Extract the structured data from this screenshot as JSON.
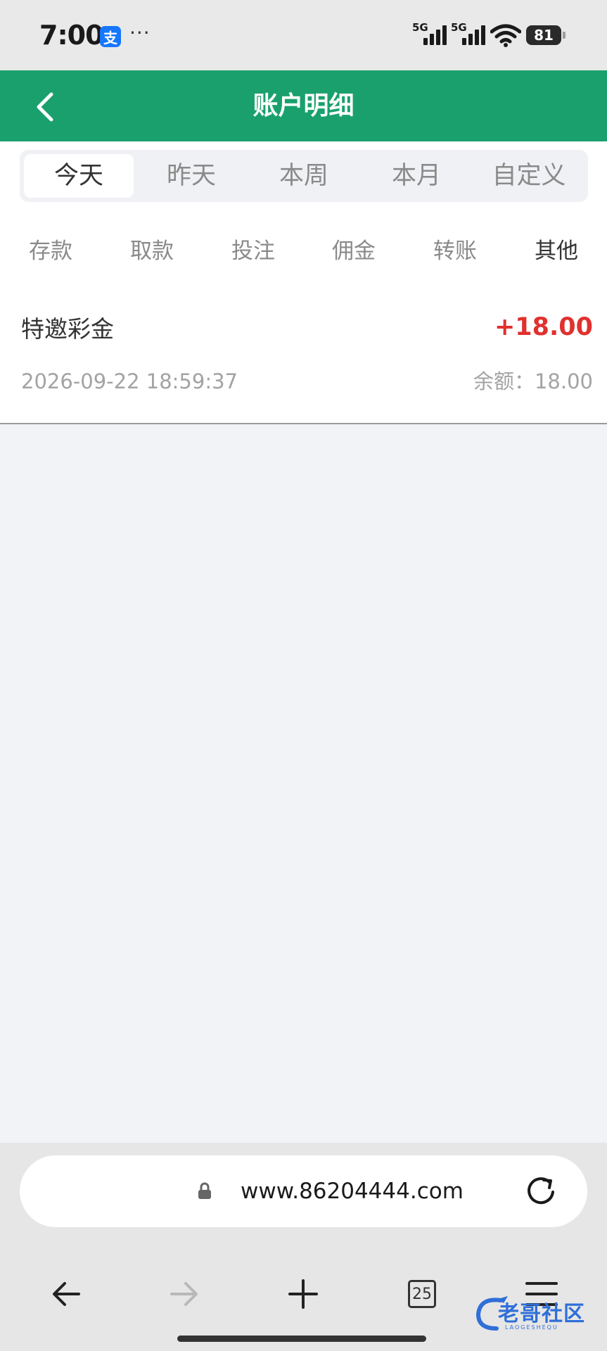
{
  "status_bar": {
    "time": "7:00",
    "app_icon_glyph": "支",
    "more_dots": "···",
    "network_1": "5G",
    "network_2": "5G",
    "battery": "81"
  },
  "header": {
    "title": "账户明细"
  },
  "period_tabs": [
    {
      "label": "今天",
      "active": true
    },
    {
      "label": "昨天",
      "active": false
    },
    {
      "label": "本周",
      "active": false
    },
    {
      "label": "本月",
      "active": false
    },
    {
      "label": "自定义",
      "active": false
    }
  ],
  "type_tabs": [
    {
      "label": "存款",
      "active": false
    },
    {
      "label": "取款",
      "active": false
    },
    {
      "label": "投注",
      "active": false
    },
    {
      "label": "佣金",
      "active": false
    },
    {
      "label": "转账",
      "active": false
    },
    {
      "label": "其他",
      "active": true
    }
  ],
  "records": [
    {
      "title": "特邀彩金",
      "amount": "+18.00",
      "time": "2026-09-22 18:59:37",
      "balance": "余额：18.00"
    }
  ],
  "browser": {
    "url": "www.86204444.com",
    "tab_count": "25"
  },
  "watermark": {
    "text": "老哥社区",
    "subtext": "LAOGESHEQU"
  },
  "colors": {
    "header_bg": "#1aa06d",
    "amount": "#e0312f",
    "page_bg": "#f1f3f7"
  }
}
